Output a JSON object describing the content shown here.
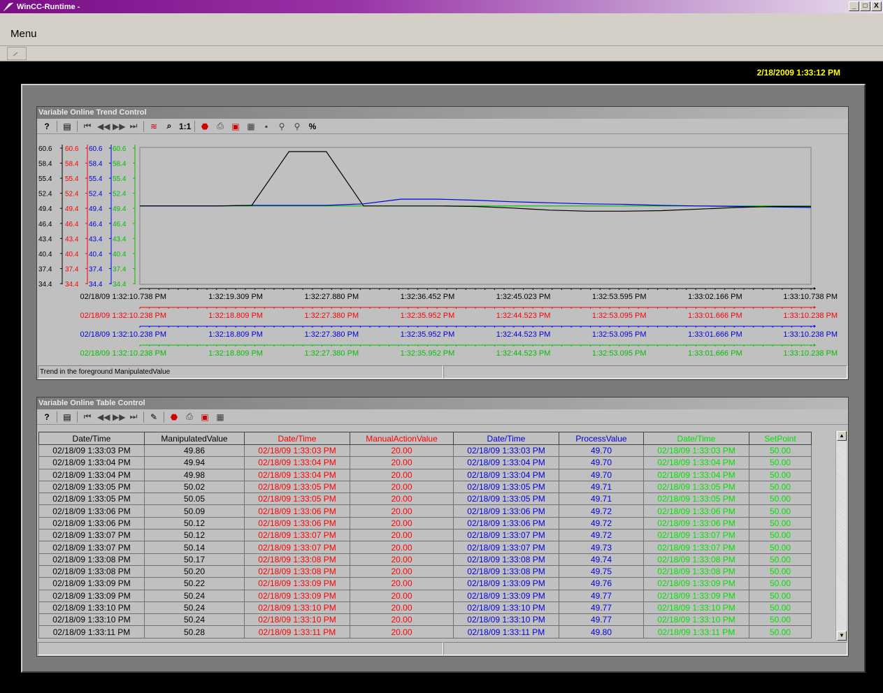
{
  "window": {
    "title": "WinCC-Runtime -",
    "minimize": "_",
    "maximize": "□",
    "close": "X"
  },
  "menu": {
    "label": "Menu"
  },
  "clock": "2/18/2009 1:33:12 PM",
  "trend_control": {
    "title": "Variable Online Trend Control",
    "status_text": "Trend in the foreground ManipulatedValue",
    "y_ticks": [
      "60.6",
      "58.4",
      "55.4",
      "52.4",
      "49.4",
      "46.4",
      "43.4",
      "40.4",
      "37.4",
      "34.4"
    ],
    "time_axes": [
      {
        "color": "#000000",
        "labels": [
          "02/18/09  1:32:10.738 PM",
          "1:32:19.309 PM",
          "1:32:27.880 PM",
          "1:32:36.452 PM",
          "1:32:45.023 PM",
          "1:32:53.595 PM",
          "1:33:02.166 PM",
          "1:33:10.738 PM"
        ]
      },
      {
        "color": "#ff0000",
        "labels": [
          "02/18/09  1:32:10.238 PM",
          "1:32:18.809 PM",
          "1:32:27.380 PM",
          "1:32:35.952 PM",
          "1:32:44.523 PM",
          "1:32:53.095 PM",
          "1:33:01.666 PM",
          "1:33:10.238 PM"
        ]
      },
      {
        "color": "#0000e0",
        "labels": [
          "02/18/09  1:32:10.238 PM",
          "1:32:18.809 PM",
          "1:32:27.380 PM",
          "1:32:35.952 PM",
          "1:32:44.523 PM",
          "1:32:53.095 PM",
          "1:33:01.666 PM",
          "1:33:10.238 PM"
        ]
      },
      {
        "color": "#00c000",
        "labels": [
          "02/18/09  1:32:10.238 PM",
          "1:32:18.809 PM",
          "1:32:27.380 PM",
          "1:32:35.952 PM",
          "1:32:44.523 PM",
          "1:32:53.095 PM",
          "1:33:01.666 PM",
          "1:33:10.238 PM"
        ]
      }
    ]
  },
  "table_control": {
    "title": "Variable Online Table Control",
    "headers": [
      {
        "label": "Date/Time",
        "cls": "c-black"
      },
      {
        "label": "ManipulatedValue",
        "cls": "c-black"
      },
      {
        "label": "Date/Time",
        "cls": "c-red"
      },
      {
        "label": "ManualActionValue",
        "cls": "c-red"
      },
      {
        "label": "Date/Time",
        "cls": "c-blue"
      },
      {
        "label": "ProcessValue",
        "cls": "c-blue"
      },
      {
        "label": "Date/Time",
        "cls": "c-green"
      },
      {
        "label": "SetPoint",
        "cls": "c-green"
      }
    ],
    "rows": [
      [
        "02/18/09 1:33:03 PM",
        "49.86",
        "02/18/09 1:33:03 PM",
        "20.00",
        "02/18/09 1:33:03 PM",
        "49.70",
        "02/18/09 1:33:03 PM",
        "50.00"
      ],
      [
        "02/18/09 1:33:04 PM",
        "49.94",
        "02/18/09 1:33:04 PM",
        "20.00",
        "02/18/09 1:33:04 PM",
        "49.70",
        "02/18/09 1:33:04 PM",
        "50.00"
      ],
      [
        "02/18/09 1:33:04 PM",
        "49.98",
        "02/18/09 1:33:04 PM",
        "20.00",
        "02/18/09 1:33:04 PM",
        "49.70",
        "02/18/09 1:33:04 PM",
        "50.00"
      ],
      [
        "02/18/09 1:33:05 PM",
        "50.02",
        "02/18/09 1:33:05 PM",
        "20.00",
        "02/18/09 1:33:05 PM",
        "49.71",
        "02/18/09 1:33:05 PM",
        "50.00"
      ],
      [
        "02/18/09 1:33:05 PM",
        "50.05",
        "02/18/09 1:33:05 PM",
        "20.00",
        "02/18/09 1:33:05 PM",
        "49.71",
        "02/18/09 1:33:05 PM",
        "50.00"
      ],
      [
        "02/18/09 1:33:06 PM",
        "50.09",
        "02/18/09 1:33:06 PM",
        "20.00",
        "02/18/09 1:33:06 PM",
        "49.72",
        "02/18/09 1:33:06 PM",
        "50.00"
      ],
      [
        "02/18/09 1:33:06 PM",
        "50.12",
        "02/18/09 1:33:06 PM",
        "20.00",
        "02/18/09 1:33:06 PM",
        "49.72",
        "02/18/09 1:33:06 PM",
        "50.00"
      ],
      [
        "02/18/09 1:33:07 PM",
        "50.12",
        "02/18/09 1:33:07 PM",
        "20.00",
        "02/18/09 1:33:07 PM",
        "49.72",
        "02/18/09 1:33:07 PM",
        "50.00"
      ],
      [
        "02/18/09 1:33:07 PM",
        "50.14",
        "02/18/09 1:33:07 PM",
        "20.00",
        "02/18/09 1:33:07 PM",
        "49.73",
        "02/18/09 1:33:07 PM",
        "50.00"
      ],
      [
        "02/18/09 1:33:08 PM",
        "50.17",
        "02/18/09 1:33:08 PM",
        "20.00",
        "02/18/09 1:33:08 PM",
        "49.74",
        "02/18/09 1:33:08 PM",
        "50.00"
      ],
      [
        "02/18/09 1:33:08 PM",
        "50.20",
        "02/18/09 1:33:08 PM",
        "20.00",
        "02/18/09 1:33:08 PM",
        "49.75",
        "02/18/09 1:33:08 PM",
        "50.00"
      ],
      [
        "02/18/09 1:33:09 PM",
        "50.22",
        "02/18/09 1:33:09 PM",
        "20.00",
        "02/18/09 1:33:09 PM",
        "49.76",
        "02/18/09 1:33:09 PM",
        "50.00"
      ],
      [
        "02/18/09 1:33:09 PM",
        "50.24",
        "02/18/09 1:33:09 PM",
        "20.00",
        "02/18/09 1:33:09 PM",
        "49.77",
        "02/18/09 1:33:09 PM",
        "50.00"
      ],
      [
        "02/18/09 1:33:10 PM",
        "50.24",
        "02/18/09 1:33:10 PM",
        "20.00",
        "02/18/09 1:33:10 PM",
        "49.77",
        "02/18/09 1:33:10 PM",
        "50.00"
      ],
      [
        "02/18/09 1:33:10 PM",
        "50.24",
        "02/18/09 1:33:10 PM",
        "20.00",
        "02/18/09 1:33:10 PM",
        "49.77",
        "02/18/09 1:33:10 PM",
        "50.00"
      ],
      [
        "02/18/09 1:33:11 PM",
        "50.28",
        "02/18/09 1:33:11 PM",
        "20.00",
        "02/18/09 1:33:11 PM",
        "49.80",
        "02/18/09 1:33:11 PM",
        "50.00"
      ]
    ]
  },
  "chart_data": {
    "type": "line",
    "ylim": [
      34.4,
      60.6
    ],
    "series": [
      {
        "color": "#000000",
        "values": [
          49.4,
          49.4,
          49.4,
          49.5,
          59.8,
          59.8,
          49.4,
          49.4,
          49.4,
          49.3,
          49.0,
          48.6,
          48.4,
          48.4,
          48.5,
          48.8,
          49.1,
          49.3,
          49.3
        ]
      },
      {
        "color": "#0000e0",
        "values": [
          49.4,
          49.4,
          49.4,
          49.5,
          49.5,
          49.5,
          49.8,
          50.7,
          50.7,
          50.5,
          50.2,
          50.0,
          49.8,
          49.7,
          49.5,
          49.4,
          49.3,
          49.2,
          49.1
        ]
      },
      {
        "color": "#00c000",
        "values": [
          49.4,
          49.4,
          49.4,
          49.4,
          49.4,
          49.4,
          49.4,
          49.4,
          49.4,
          49.4,
          49.4,
          49.4,
          49.4,
          49.4,
          49.4,
          49.4,
          49.4,
          49.4,
          49.4
        ]
      }
    ]
  }
}
